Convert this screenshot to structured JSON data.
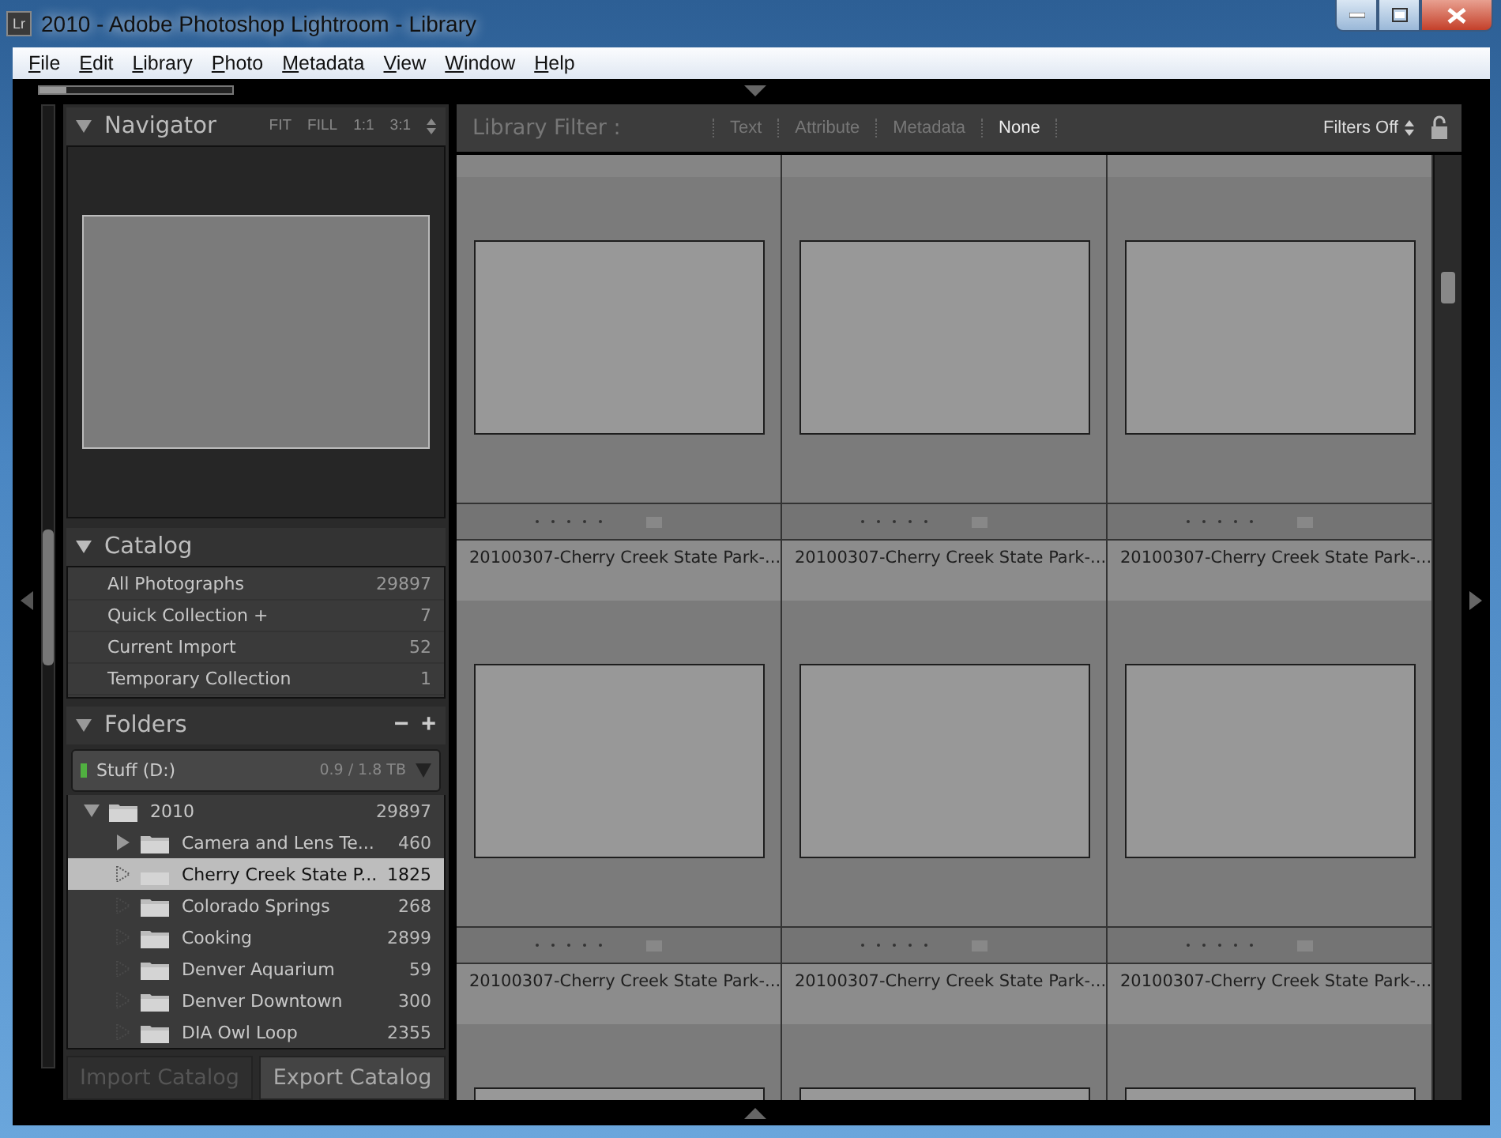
{
  "window": {
    "app_icon": "Lr",
    "title": "2010 - Adobe Photoshop Lightroom - Library"
  },
  "menu": [
    "File",
    "Edit",
    "Library",
    "Photo",
    "Metadata",
    "View",
    "Window",
    "Help"
  ],
  "navigator": {
    "title": "Navigator",
    "expanded": true,
    "zoom_options": [
      "FIT",
      "FILL",
      "1:1",
      "3:1"
    ]
  },
  "catalog": {
    "title": "Catalog",
    "expanded": true,
    "items": [
      {
        "label": "All Photographs",
        "count": "29897"
      },
      {
        "label": "Quick Collection +",
        "count": "7"
      },
      {
        "label": "Current Import",
        "count": "52"
      },
      {
        "label": "Temporary Collection",
        "count": "1"
      }
    ]
  },
  "folders": {
    "title": "Folders",
    "expanded": true,
    "actions": [
      "−",
      "+"
    ],
    "volume": {
      "name": "Stuff (D:)",
      "usage": "0.9 / 1.8 TB"
    },
    "tree": [
      {
        "label": "2010",
        "count": "29897",
        "kind": "expanded",
        "selected": false,
        "children": [
          {
            "label": "Camera and Lens Te...",
            "count": "460",
            "kind": "collapsed",
            "selected": false
          },
          {
            "label": "Cherry Creek State P...",
            "count": "1825",
            "kind": "leaf",
            "selected": true
          },
          {
            "label": "Colorado Springs",
            "count": "268",
            "kind": "leaf",
            "selected": false
          },
          {
            "label": "Cooking",
            "count": "2899",
            "kind": "leaf",
            "selected": false
          },
          {
            "label": "Denver Aquarium",
            "count": "59",
            "kind": "leaf",
            "selected": false
          },
          {
            "label": "Denver Downtown",
            "count": "300",
            "kind": "leaf",
            "selected": false
          },
          {
            "label": "DIA Owl Loop",
            "count": "2355",
            "kind": "leaf",
            "selected": false
          }
        ]
      }
    ]
  },
  "buttons": [
    {
      "label": "Import Catalog",
      "disabled": true
    },
    {
      "label": "Export Catalog",
      "disabled": false
    }
  ],
  "filter_bar": {
    "title": "Library Filter :",
    "tabs": [
      {
        "label": "Text",
        "selected": false
      },
      {
        "label": "Attribute",
        "selected": false
      },
      {
        "label": "Metadata",
        "selected": false
      },
      {
        "label": "None",
        "selected": true
      }
    ],
    "preset": "Filters Off"
  },
  "grid": {
    "rows": [
      {
        "cells": [
          {
            "filename": "20100307-Cherry Creek State Park-..."
          },
          {
            "filename": "20100307-Cherry Creek State Park-..."
          },
          {
            "filename": "20100307-Cherry Creek State Park-..."
          }
        ]
      },
      {
        "cells": [
          {
            "filename": "20100307-Cherry Creek State Park-..."
          },
          {
            "filename": "20100307-Cherry Creek State Park-..."
          },
          {
            "filename": "20100307-Cherry Creek State Park-..."
          }
        ]
      }
    ]
  }
}
